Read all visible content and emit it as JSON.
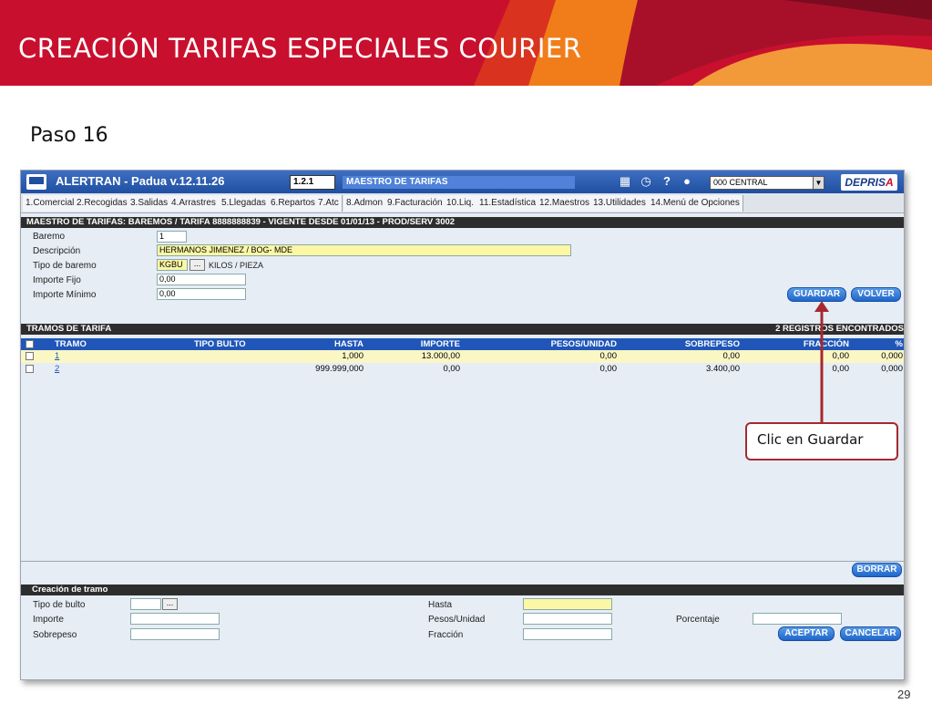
{
  "slide": {
    "title": "CREACIÓN TARIFAS ESPECIALES COURIER",
    "step": "Paso 16",
    "page_number": "29",
    "callout": "Clic en Guardar",
    "colors": {
      "banner": "#c8102e",
      "accent_orange": "#f07d1a"
    }
  },
  "app": {
    "title": "ALERTRAN - Padua  v.12.11.26",
    "code": "1.2.1",
    "module": "MAESTRO DE TARIFAS",
    "branch": "000 CENTRAL",
    "brand": {
      "a": "DEPRIS",
      "b": "A"
    },
    "icons": [
      "calendar-icon",
      "clock-icon",
      "help-icon",
      "user-icon"
    ]
  },
  "menu": [
    "1.Comercial",
    "2.Recogidas",
    "3.Salidas",
    "4.Arrastres",
    "5.Llegadas",
    "6.Repartos",
    "7.Atc",
    "8.Admon",
    "9.Facturación",
    "10.Liq.",
    "11.Estadística",
    "12.Maestros",
    "13.Utilidades",
    "14.Menú de Opciones"
  ],
  "header_section": {
    "title": "MAESTRO DE TARIFAS: BAREMOS   /   TARIFA 8888888839   -   VIGENTE DESDE 01/01/13   -   PROD/SERV 3002",
    "labels": {
      "baremo": "Baremo",
      "descripcion": "Descripción",
      "tipo": "Tipo de baremo",
      "importe_fijo": "Importe Fijo",
      "importe_minimo": "Importe Mínimo"
    },
    "values": {
      "baremo": "1",
      "descripcion": "HERMANOS JIMENEZ / BOG- MDE",
      "tipo": "KGBU",
      "tipo_desc": "KILOS / PIEZA",
      "importe_fijo": "0,00",
      "importe_minimo": "0,00"
    },
    "buttons": {
      "guardar": "GUARDAR",
      "volver": "VOLVER"
    }
  },
  "tramos": {
    "title": "TRAMOS DE TARIFA",
    "count": "2 REGISTROS ENCONTRADOS",
    "columns": [
      "TRAMO",
      "TIPO BULTO",
      "HASTA",
      "IMPORTE",
      "PESOS/UNIDAD",
      "SOBREPESO",
      "FRACCIÓN",
      "%"
    ],
    "rows": [
      {
        "tramo": "1",
        "tipo_bulto": "",
        "hasta": "1,000",
        "importe": "13.000,00",
        "pesos": "0,00",
        "sobrepeso": "0,00",
        "fraccion": "0,00",
        "pct": "0,000"
      },
      {
        "tramo": "2",
        "tipo_bulto": "",
        "hasta": "999.999,000",
        "importe": "0,00",
        "pesos": "0,00",
        "sobrepeso": "3.400,00",
        "fraccion": "0,00",
        "pct": "0,000"
      }
    ],
    "borrar": "BORRAR"
  },
  "creacion": {
    "title": "Creación de tramo",
    "labels": {
      "tipo_bulto": "Tipo de bulto",
      "importe": "Importe",
      "sobrepeso": "Sobrepeso",
      "hasta": "Hasta",
      "pesos": "Pesos/Unidad",
      "fraccion": "Fracción",
      "porcentaje": "Porcentaje"
    },
    "buttons": {
      "aceptar": "ACEPTAR",
      "cancelar": "CANCELAR"
    }
  }
}
